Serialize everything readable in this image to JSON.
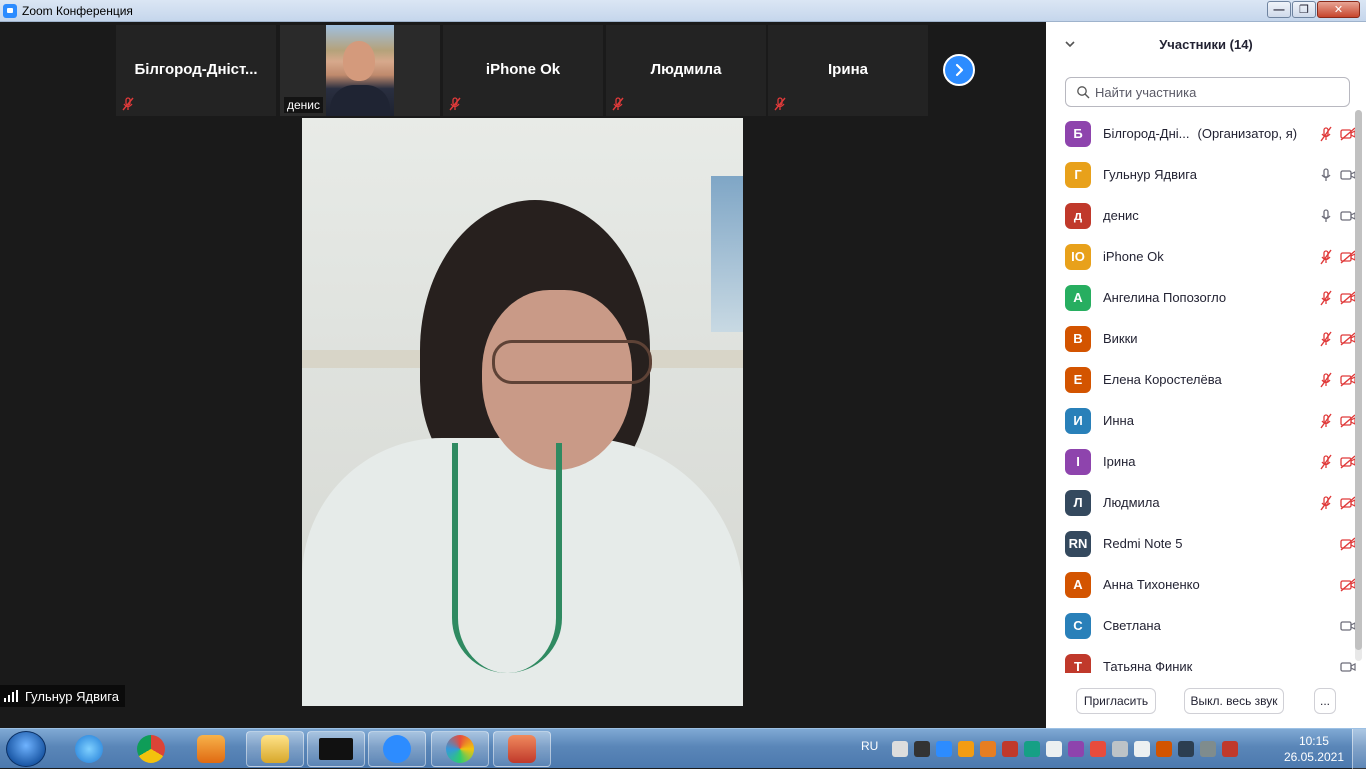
{
  "window": {
    "title": "Zoom Конференция"
  },
  "thumbnails": [
    {
      "name": "Білгород-Дніст...",
      "muted": true,
      "photo": false
    },
    {
      "name": "денис",
      "muted": false,
      "photo": true
    },
    {
      "name": "iPhone Ok",
      "muted": true,
      "photo": false
    },
    {
      "name": "Людмила",
      "muted": true,
      "photo": false
    },
    {
      "name": "Ірина",
      "muted": true,
      "photo": false
    }
  ],
  "active_speaker": {
    "name": "Гульнур Ядвига"
  },
  "panel": {
    "title": "Участники (14)",
    "search_placeholder": "Найти участника",
    "participants": [
      {
        "initial": "Б",
        "color": "#8e44ad",
        "name": "Білгород-Дні...",
        "tag": "(Организатор, я)",
        "mic": "muted",
        "cam": "off"
      },
      {
        "initial": "Г",
        "color": "#e8a11b",
        "name": "Гульнур Ядвига",
        "tag": "",
        "mic": "on",
        "cam": "on"
      },
      {
        "initial": "д",
        "color": "#c0392b",
        "name": "денис",
        "tag": "",
        "mic": "on",
        "cam": "on"
      },
      {
        "initial": "IO",
        "color": "#e8a11b",
        "name": "iPhone Ok",
        "tag": "",
        "mic": "muted",
        "cam": "off"
      },
      {
        "initial": "А",
        "color": "#27ae60",
        "name": "Ангелина Попозогло",
        "tag": "",
        "mic": "muted",
        "cam": "off"
      },
      {
        "initial": "В",
        "color": "#d35400",
        "name": "Викки",
        "tag": "",
        "mic": "muted",
        "cam": "off"
      },
      {
        "initial": "Е",
        "color": "#d35400",
        "name": "Елена Коростелёва",
        "tag": "",
        "mic": "muted",
        "cam": "off"
      },
      {
        "initial": "И",
        "color": "#2980b9",
        "name": "Инна",
        "tag": "",
        "mic": "muted",
        "cam": "off"
      },
      {
        "initial": "І",
        "color": "#8e44ad",
        "name": "Ірина",
        "tag": "",
        "mic": "muted",
        "cam": "off"
      },
      {
        "initial": "Л",
        "color": "#34495e",
        "name": "Людмила",
        "tag": "",
        "mic": "muted",
        "cam": "off"
      },
      {
        "initial": "RN",
        "color": "#34495e",
        "name": "Redmi Note 5",
        "tag": "",
        "mic": "none",
        "cam": "off"
      },
      {
        "initial": "А",
        "color": "#d35400",
        "name": "Анна Тихоненко",
        "tag": "",
        "mic": "none",
        "cam": "off"
      },
      {
        "initial": "С",
        "color": "#2980b9",
        "name": "Светлана",
        "tag": "",
        "mic": "none",
        "cam": "on"
      },
      {
        "initial": "Т",
        "color": "#c0392b",
        "name": "Татьяна Финик",
        "tag": "",
        "mic": "none",
        "cam": "on"
      }
    ],
    "footer": {
      "invite": "Пригласить",
      "mute_all": "Выкл. весь звук",
      "more": "..."
    }
  },
  "taskbar": {
    "apps": [
      "ie-icon",
      "chrome-icon",
      "media-player-icon",
      "explorer-icon",
      "asus-icon",
      "zoom-icon",
      "paint-icon",
      "powerpoint-icon"
    ],
    "lang": "RU",
    "time": "10:15",
    "date": "26.05.2021"
  },
  "colors": {
    "zoom_blue": "#2d8cff",
    "muted_red": "#e03a3a",
    "panel_bg": "#ffffff",
    "video_bg": "#1a1a1a"
  }
}
